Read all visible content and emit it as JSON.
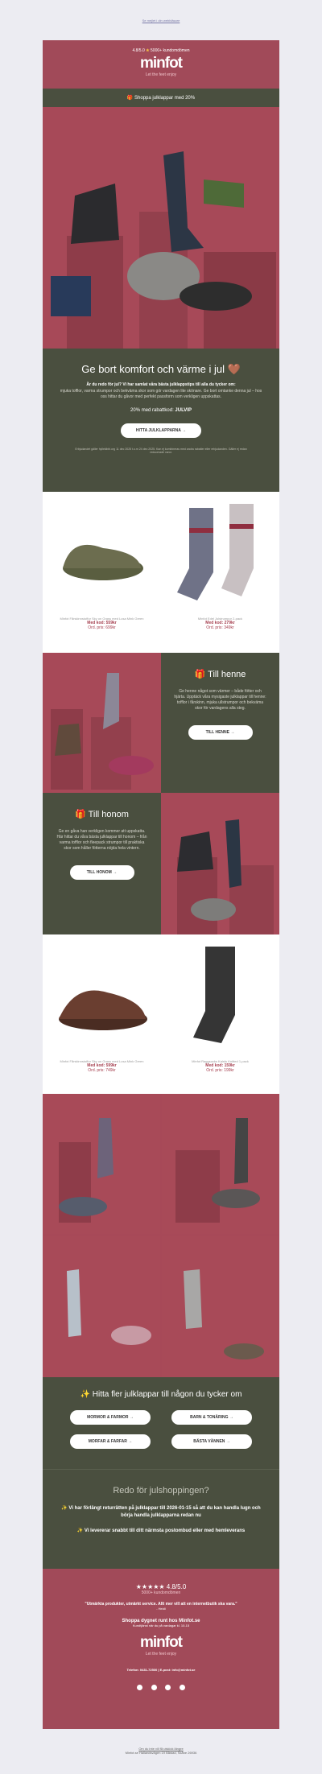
{
  "top_link": "Se mejlet i din webbläsare",
  "header": {
    "rating_prefix": "4.8/5.0",
    "rating_suffix": "5000+ kundomdömen",
    "logo": "minfot",
    "tagline": "Let the feet enjoy",
    "promo": "🎁 Shoppa julklappar med 20%"
  },
  "intro": {
    "title": "Ge bort komfort och värme i jul 🤎",
    "lead": "Är du redo för jul? Vi har samlat våra bästa julklappstips till alla du tycker om:",
    "body": "mjuka tofflor, varma strumpor och bekväma skor som gör vardagen lite skönare. Ge bort omtanke denna jul – hos oss hittar du gåvor med perfekt passform som verkligen uppskattas.",
    "discount_text": "20% med rabattkod:",
    "discount_code": "JULVIP",
    "button": "HITTA JULKLAPPARNA →",
    "fineprint": "Erbjudandet gäller hyllekibbl.org 11 dec 2025 t.o.m 24 dec 2025. Kan ej kombineras med andra rabatter eller erbjudanden. Gäller ej redan reducerade varor."
  },
  "products1": [
    {
      "name": "Minfot Fårskinnstoffor Sky on Grass med Lusa Mink Green",
      "sale": "Med kod: 559kr",
      "orig": "Ord. pris: 699kr"
    },
    {
      "name": "Minfot Edel Julstrumpor 2-pack",
      "sale": "Med kod: 279kr",
      "orig": "Ord. pris: 349kr"
    }
  ],
  "her": {
    "title": "🎁 Till henne",
    "body": "Ge henne något som värmer – både fötter och hjärta. Upptäck våra mysigaste julklappar till henne: tofflor i fårskinn, mjuka ullstrumpor och bekväma skor för vardagens alla steg.",
    "button": "TILL HENNE →"
  },
  "him": {
    "title": "🎁 Till honom",
    "body": "Ge en gåva han verkligen kommer att uppskatta. Här hittar du våra bästa julklappar till honom – från varma tofflor och fleepack strumpor till praktiska skor som håller fötterna nöjda hela vintern.",
    "button": "TILL HONOM →"
  },
  "products2": [
    {
      "name": "Minfot Fårskinnstoffor Sky on Grass med Lusa Mink Green",
      "sale": "Med kod: 599kr",
      "orig": "Ord. pris: 749kr"
    },
    {
      "name": "Minfot Raggsocks Kalsfu Knitted 1-pack",
      "sale": "Med kod: 159kr",
      "orig": "Ord. pris: 199kr"
    }
  ],
  "gifts": {
    "title": "✨ Hitta fler julklappar till någon du tycker om",
    "buttons": [
      "MORMOR & FARMOR →",
      "BARN & TONÅRING →",
      "MORFAR & FARFAR →",
      "BÄSTA VÄNNEN →"
    ]
  },
  "ready": {
    "title": "Redo för julshoppingen?",
    "line1": "✨ Vi har förlängt returrätten på julklappar till 2026-01-15 så att du kan handla lugn och börja handla julklapparna redan nu",
    "line2": "✨ Vi levererar snabbt till ditt närmsta postombud eller med hemleverans"
  },
  "footer": {
    "stars": "★★★★★ 4.8/5.0",
    "reviews": "5000+ kundomdömen",
    "quote": "\"Utmärkta produkter, utmärkt service. Allt mer vill att en internetbutik ska vara.\"",
    "author": "- Heidi",
    "shop": "Shoppa dygnet runt hos Minfot.se",
    "service": "Kundtjänst när du på vardagar kl. 10-15",
    "logo": "minfot",
    "tagline": "Let the feet enjoy",
    "contact": "Telefon: 0431-72500 | E-post: info@minfot.se",
    "icons": [
      "facebook-icon",
      "instagram-icon",
      "tiktok-icon",
      "youtube-icon"
    ]
  },
  "bottom": {
    "unsub": "Om du inte vill få utskick längre",
    "address": "Minfot.se Hallandsvägen 19 Båstad, Skåne 26936"
  }
}
